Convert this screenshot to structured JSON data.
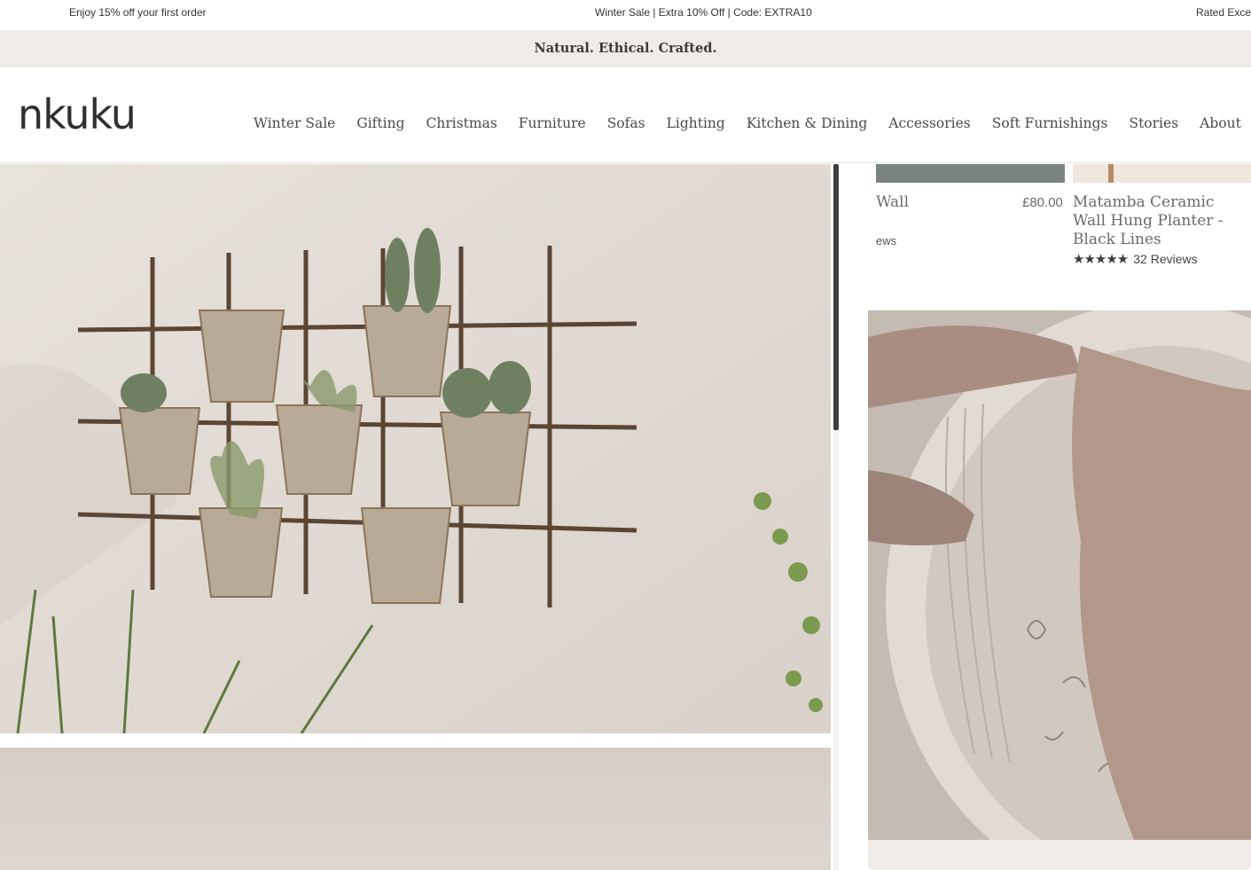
{
  "promo": {
    "left": "Enjoy 15% off your first order",
    "center": "Winter Sale | Extra 10% Off | Code: EXTRA10",
    "right": "Rated Excell"
  },
  "tagline": "Natural. Ethical. Crafted.",
  "brand": {
    "logo": "nkuku"
  },
  "nav": {
    "items": [
      "Winter Sale",
      "Gifting",
      "Christmas",
      "Furniture",
      "Sofas",
      "Lighting",
      "Kitchen & Dining",
      "Accessories",
      "Soft Furnishings",
      "Stories",
      "About"
    ]
  },
  "products": [
    {
      "name": "Wall",
      "price": "£80.00",
      "reviews": "ews"
    },
    {
      "name": "Matamba Ceramic Wall Hung Planter - Black Lines",
      "stars": "★★★★★",
      "reviews": "32 Reviews",
      "rating": 5
    }
  ],
  "colors": {
    "tagline_bg": "#efebe8",
    "text": "#2b2b2b",
    "muted": "#6a6a6a"
  }
}
